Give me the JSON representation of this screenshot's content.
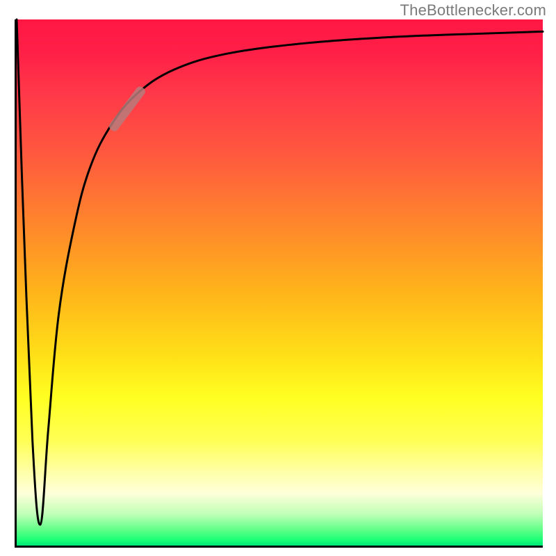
{
  "attribution": "TheBottlenecker.com",
  "chart_data": {
    "type": "line",
    "title": "",
    "xlabel": "",
    "ylabel": "",
    "xlim": [
      0,
      100
    ],
    "ylim": [
      0,
      100
    ],
    "grid": false,
    "legend": false,
    "background_gradient": {
      "orientation": "vertical",
      "stops": [
        {
          "pos": 0.0,
          "color": "#ff1744"
        },
        {
          "pos": 0.4,
          "color": "#ff8a2a"
        },
        {
          "pos": 0.7,
          "color": "#ffff22"
        },
        {
          "pos": 0.9,
          "color": "#ffffda"
        },
        {
          "pos": 1.0,
          "color": "#00e876"
        }
      ]
    },
    "series": [
      {
        "name": "curve",
        "x": [
          0,
          1,
          3,
          4.5,
          6,
          8,
          11,
          14,
          18,
          23,
          30,
          40,
          55,
          72,
          88,
          100
        ],
        "y": [
          100,
          70,
          20,
          4,
          22,
          44,
          61,
          72,
          80,
          86,
          90.5,
          93.5,
          95.5,
          96.7,
          97.3,
          97.7
        ],
        "note": "Values estimated from pixel positions; y is 100 at top of plot area, 0 at bottom. Sharp trough near x≈4.5 reaching ~4, asymptote near ~97.7."
      }
    ],
    "marker": {
      "series": "curve",
      "x_range": [
        18,
        24
      ],
      "y_range": [
        79,
        87
      ],
      "color": "#b77b7b",
      "note": "short thick pale-red segment overlaid on the curve"
    }
  }
}
